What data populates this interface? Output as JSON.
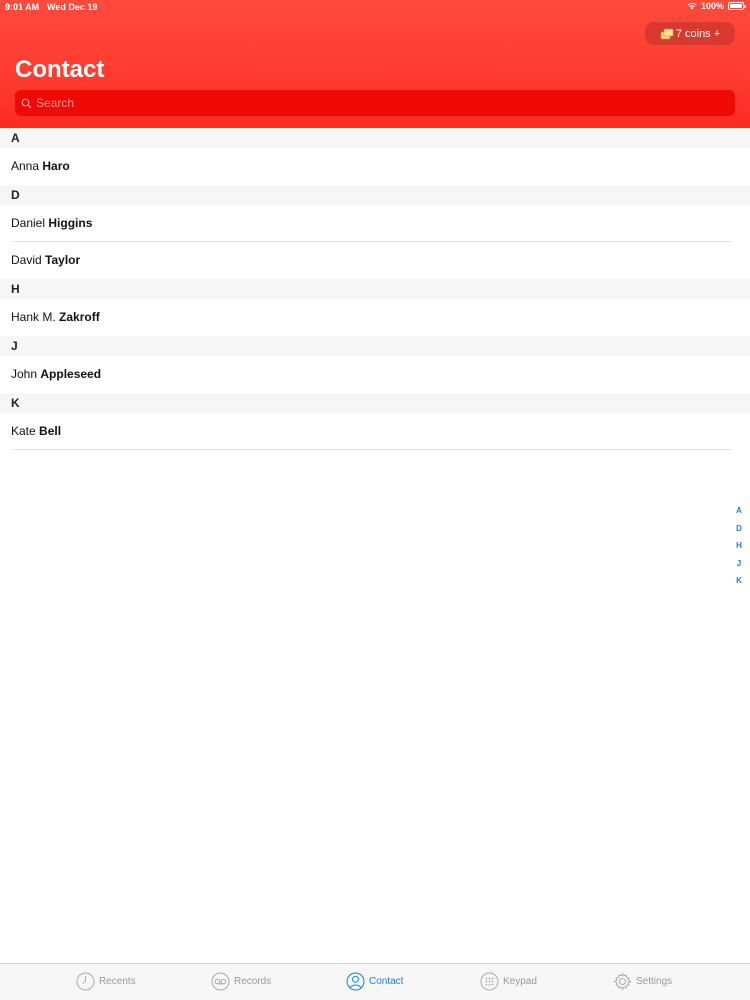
{
  "status_bar": {
    "time": "9:01 AM",
    "date": "Wed Dec 19",
    "battery": "100%"
  },
  "header": {
    "coins_label": "7 coins +",
    "title": "Contact",
    "search_placeholder": "Search"
  },
  "sections": [
    {
      "letter": "A",
      "contacts": [
        {
          "first": "Anna",
          "last": "Haro"
        }
      ]
    },
    {
      "letter": "D",
      "contacts": [
        {
          "first": "Daniel",
          "last": "Higgins"
        },
        {
          "first": "David",
          "last": "Taylor"
        }
      ]
    },
    {
      "letter": "H",
      "contacts": [
        {
          "first": "Hank M.",
          "last": "Zakroff"
        }
      ]
    },
    {
      "letter": "J",
      "contacts": [
        {
          "first": "John",
          "last": "Appleseed"
        }
      ]
    },
    {
      "letter": "K",
      "contacts": [
        {
          "first": "Kate",
          "last": "Bell"
        }
      ]
    }
  ],
  "index_letters": [
    "A",
    "D",
    "H",
    "J",
    "K"
  ],
  "tabs": [
    {
      "label": "Recents",
      "icon": "clock-icon"
    },
    {
      "label": "Records",
      "icon": "records-icon"
    },
    {
      "label": "Contact",
      "icon": "person-icon",
      "active": true
    },
    {
      "label": "Keypad",
      "icon": "keypad-icon"
    },
    {
      "label": "Settings",
      "icon": "gear-icon"
    }
  ],
  "colors": {
    "header_red": "#ff3b30",
    "search_red": "#f00a06",
    "accent_blue": "#1a7ee0",
    "tab_inactive": "#999999"
  }
}
